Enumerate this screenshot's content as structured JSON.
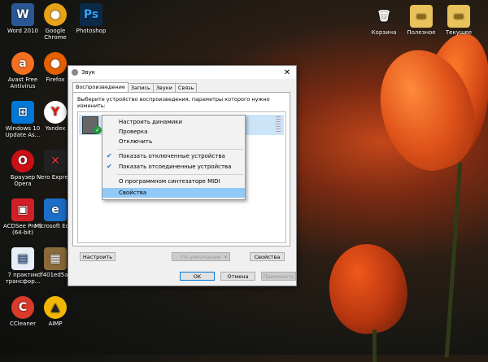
{
  "desktop": {
    "icons": [
      {
        "label": "Word 2010",
        "color": "#2b5796",
        "glyph": "W"
      },
      {
        "label": "Google Chrome",
        "color": "#e8a218",
        "glyph": "●"
      },
      {
        "label": "Photoshop",
        "color": "#0b2a4a",
        "glyph": "Ps"
      },
      {
        "label": "Avast Free Antivirus",
        "color": "#f37021",
        "glyph": "a"
      },
      {
        "label": "Firefox",
        "color": "#e66000",
        "glyph": "●"
      },
      {
        "label": "Windows 10 Update As...",
        "color": "#0078d7",
        "glyph": "⊞"
      },
      {
        "label": "Yandex",
        "color": "#ffffff",
        "glyph": "Y"
      },
      {
        "label": "Браузер Opera",
        "color": "#cc0f16",
        "glyph": "O"
      },
      {
        "label": "Nero Express",
        "color": "#222222",
        "glyph": "✕"
      },
      {
        "label": "ACDSee Pro 9 (64-bit)",
        "color": "#d21f26",
        "glyph": "▣"
      },
      {
        "label": "Microsoft Edge",
        "color": "#1b6fc8",
        "glyph": "e"
      },
      {
        "label": "7 практик трансфор...",
        "color": "#e8eef5",
        "glyph": "▤"
      },
      {
        "label": "df401ed5a...",
        "color": "#8a6a3a",
        "glyph": "▦"
      },
      {
        "label": "CCleaner",
        "color": "#d83b2a",
        "glyph": "C"
      },
      {
        "label": "AIMP",
        "color": "#f2b705",
        "glyph": "▲"
      },
      {
        "label": "Корзина",
        "color": "#6a7f9a",
        "glyph": "🗑"
      },
      {
        "label": "Полезное",
        "color": "#e8c25a",
        "glyph": "▬"
      },
      {
        "label": "Текущее",
        "color": "#e8c25a",
        "glyph": "▬"
      }
    ]
  },
  "dialog": {
    "title": "Звук",
    "close_glyph": "✕",
    "tabs": [
      "Воспроизведение",
      "Запись",
      "Звуки",
      "Связь"
    ],
    "description": "Выберите устройство воспроизведения, параметры которого нужно изменить:",
    "buttons": {
      "configure": "Настроить",
      "default": "По умолчанию",
      "default_arrow": "▾",
      "properties": "Свойства",
      "ok": "OK",
      "cancel": "Отмена",
      "apply": "Применить"
    }
  },
  "context_menu": {
    "items": [
      {
        "label": "Настроить динамики",
        "checked": false
      },
      {
        "label": "Проверка",
        "checked": false
      },
      {
        "label": "Отключить",
        "checked": false
      },
      {
        "label": "Показать отключенные устройства",
        "checked": true
      },
      {
        "label": "Показать отсоединенные устройства",
        "checked": true
      },
      {
        "label": "О программном синтезаторе MIDI",
        "checked": false
      },
      {
        "label": "Свойства",
        "checked": false,
        "highlighted": true
      }
    ],
    "check_glyph": "✔"
  }
}
